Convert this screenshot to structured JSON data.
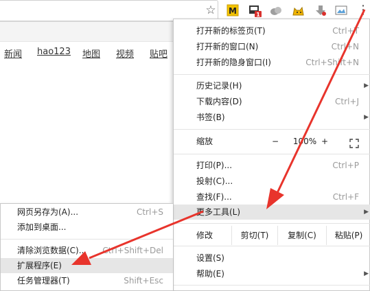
{
  "toolbar": {
    "star_icon": "star-icon",
    "extensions": [
      "M",
      "1",
      "",
      "",
      "",
      "",
      ""
    ],
    "menu_icon": "more-vert-icon"
  },
  "page": {
    "nav_links": [
      "新闻",
      "hao123",
      "地图",
      "视频",
      "贴吧"
    ]
  },
  "menu": {
    "new_tab": {
      "label": "打开新的标签页(T)",
      "shortcut": "Ctrl+T"
    },
    "new_window": {
      "label": "打开新的窗口(N)",
      "shortcut": "Ctrl+N"
    },
    "incognito": {
      "label": "打开新的隐身窗口(I)",
      "shortcut": "Ctrl+Shift+N"
    },
    "history": {
      "label": "历史记录(H)"
    },
    "downloads": {
      "label": "下载内容(D)",
      "shortcut": "Ctrl+J"
    },
    "bookmarks": {
      "label": "书签(B)"
    },
    "zoom": {
      "label": "缩放",
      "minus": "−",
      "value": "100%",
      "plus": "+"
    },
    "print": {
      "label": "打印(P)...",
      "shortcut": "Ctrl+P"
    },
    "cast": {
      "label": "投射(C)..."
    },
    "find": {
      "label": "查找(F)...",
      "shortcut": "Ctrl+F"
    },
    "more_tools": {
      "label": "更多工具(L)"
    },
    "edit": {
      "label": "修改",
      "cut": "剪切(T)",
      "copy": "复制(C)",
      "paste": "粘贴(P)"
    },
    "settings": {
      "label": "设置(S)"
    },
    "help": {
      "label": "帮助(E)"
    }
  },
  "submenu": {
    "save_as": {
      "label": "网页另存为(A)...",
      "shortcut": "Ctrl+S"
    },
    "add_desktop": {
      "label": "添加到桌面..."
    },
    "clear_data": {
      "label": "清除浏览数据(C)...",
      "shortcut": "Ctrl+Shift+Del"
    },
    "extensions": {
      "label": "扩展程序(E)"
    },
    "task_manager": {
      "label": "任务管理器(T)",
      "shortcut": "Shift+Esc"
    }
  },
  "colors": {
    "annotation_arrow": "#e8342c",
    "highlight": "#e6e6e6"
  }
}
